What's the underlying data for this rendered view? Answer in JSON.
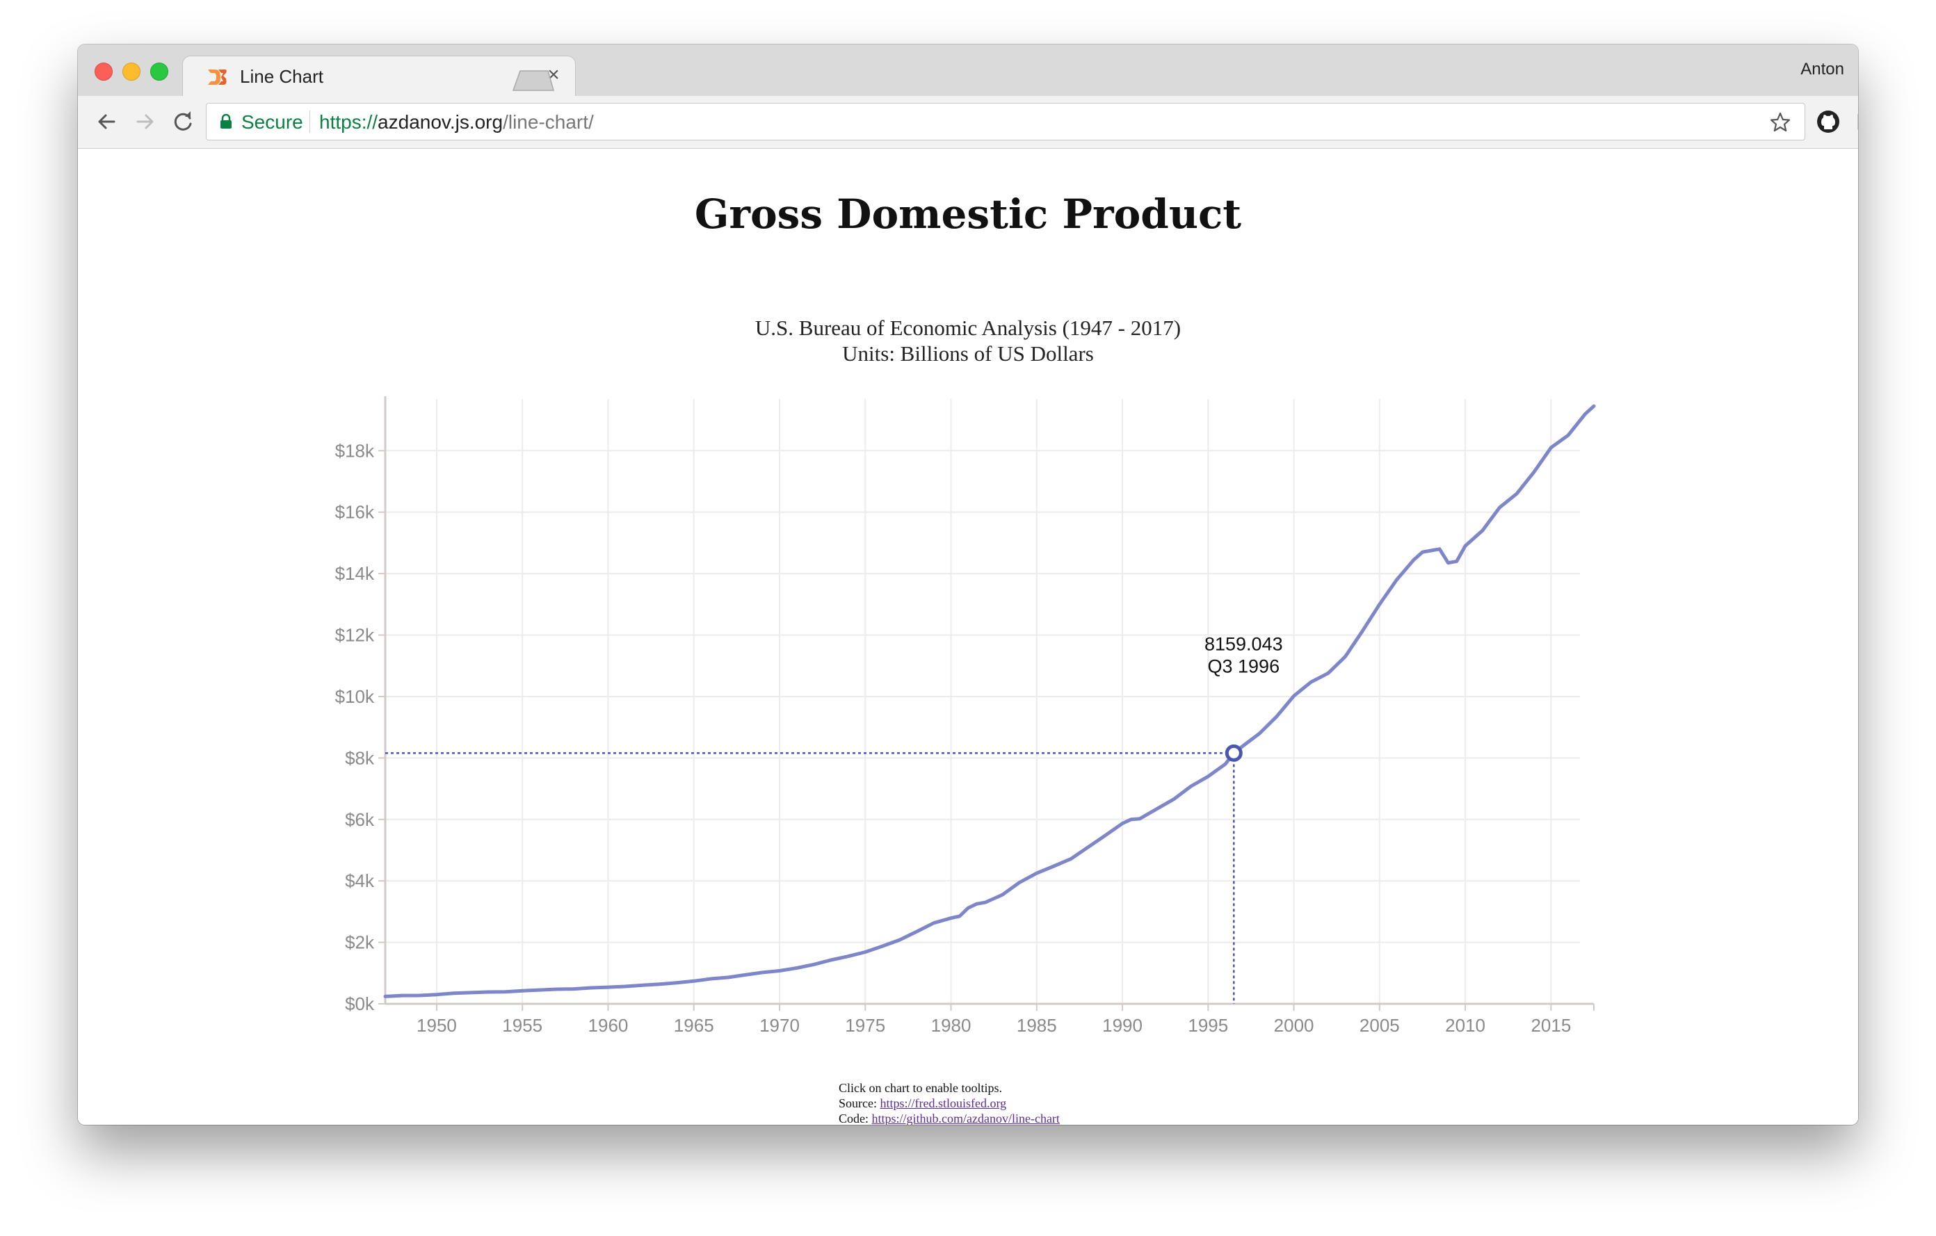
{
  "browser": {
    "tab_title": "Line Chart",
    "tab_close": "×",
    "profile_name": "Anton",
    "secure_label": "Secure",
    "url_scheme": "https://",
    "url_host": "azdanov.js.org",
    "url_path": "/line-chart/"
  },
  "page": {
    "title": "Gross Domestic Product",
    "subtitle_line1": "U.S. Bureau of Economic Analysis (1947 - 2017)",
    "subtitle_line2": "Units: Billions of US Dollars",
    "footer_hint": "Click on chart to enable tooltips.",
    "footer_source_label": "Source: ",
    "footer_source_url": "https://fred.stlouisfed.org",
    "footer_code_label": "Code: ",
    "footer_code_url": "https://github.com/azdanov/line-chart"
  },
  "chart_data": {
    "type": "line",
    "x_unit": "year",
    "xlim": [
      1947,
      2017.5
    ],
    "ylim": [
      0,
      19500
    ],
    "x_ticks": [
      1950,
      1955,
      1960,
      1965,
      1970,
      1975,
      1980,
      1985,
      1990,
      1995,
      2000,
      2005,
      2010,
      2015
    ],
    "y_ticks": [
      0,
      2000,
      4000,
      6000,
      8000,
      10000,
      12000,
      14000,
      16000,
      18000
    ],
    "y_tick_labels": [
      "$0k",
      "$2k",
      "$4k",
      "$6k",
      "$8k",
      "$10k",
      "$12k",
      "$14k",
      "$16k",
      "$18k"
    ],
    "grid": true,
    "line_color": "#7c86c8",
    "series": [
      {
        "x": [
          1947,
          1948,
          1949,
          1950,
          1951,
          1952,
          1953,
          1954,
          1955,
          1956,
          1957,
          1958,
          1959,
          1960,
          1961,
          1962,
          1963,
          1964,
          1965,
          1966,
          1967,
          1968,
          1969,
          1970,
          1971,
          1972,
          1973,
          1974,
          1975,
          1976,
          1977,
          1978,
          1979,
          1980,
          1980.5,
          1981,
          1981.5,
          1982,
          1983,
          1984,
          1985,
          1986,
          1987,
          1988,
          1989,
          1990,
          1990.5,
          1991,
          1992,
          1993,
          1994,
          1995,
          1996,
          1996.5,
          1997,
          1998,
          1999,
          2000,
          2001,
          2002,
          2003,
          2004,
          2005,
          2006,
          2007,
          2007.5,
          2008,
          2008.5,
          2009,
          2009.5,
          2010,
          2011,
          2012,
          2013,
          2014,
          2015,
          2016,
          2017,
          2017.5
        ],
        "y": [
          240,
          270,
          272,
          300,
          345,
          365,
          385,
          390,
          425,
          450,
          475,
          485,
          520,
          540,
          565,
          605,
          640,
          685,
          740,
          815,
          860,
          940,
          1020,
          1075,
          1165,
          1280,
          1425,
          1545,
          1685,
          1875,
          2080,
          2350,
          2630,
          2790,
          2850,
          3120,
          3250,
          3300,
          3550,
          3950,
          4250,
          4480,
          4720,
          5100,
          5480,
          5870,
          6000,
          6020,
          6340,
          6660,
          7080,
          7400,
          7800,
          8159.043,
          8380,
          8800,
          9350,
          10020,
          10470,
          10760,
          11300,
          12130,
          13000,
          13800,
          14450,
          14700,
          14750,
          14800,
          14350,
          14400,
          14900,
          15400,
          16150,
          16600,
          17300,
          18100,
          18500,
          19200,
          19450
        ]
      }
    ],
    "tooltip": {
      "value": "8159.043",
      "period": "Q3 1996",
      "x": 1996.5,
      "y": 8159.043
    }
  }
}
